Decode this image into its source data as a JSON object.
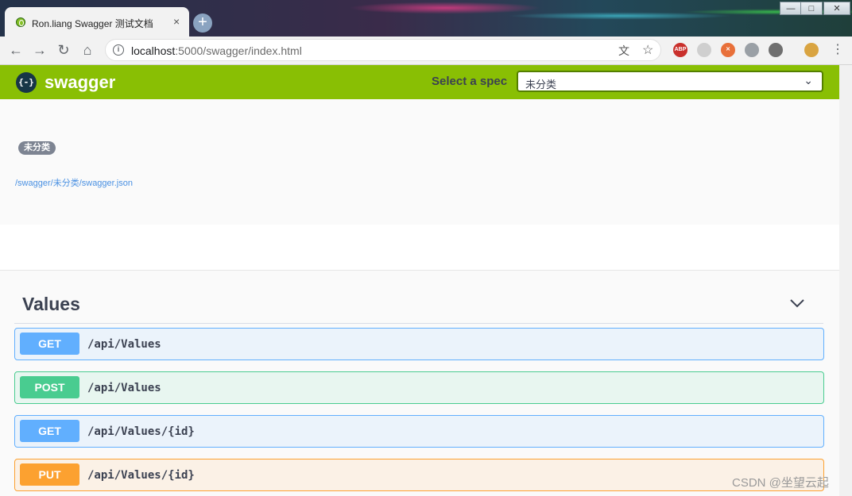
{
  "browser": {
    "tab_title": "Ron.liang Swagger 测试文档",
    "tab_close": "×",
    "new_tab": "+",
    "window_controls": {
      "minimize": "—",
      "maximize": "□",
      "close": "✕"
    },
    "url_host": "localhost",
    "url_path": ":5000/swagger/index.html",
    "extensions": [
      {
        "name": "adblock-icon",
        "label": "ABP",
        "color": "#c9302c"
      },
      {
        "name": "sync-icon",
        "label": "",
        "color": "#cfcfcf"
      },
      {
        "name": "close-circle-icon",
        "label": "✕",
        "color": "#e8703a"
      },
      {
        "name": "vue-icon",
        "label": "",
        "color": "#9aa0a6"
      },
      {
        "name": "dev-icon",
        "label": "",
        "color": "#6f6f6f"
      },
      {
        "name": "avatar-icon",
        "label": "",
        "color": "#d9a441"
      }
    ]
  },
  "swagger": {
    "logo_text": "{-}",
    "brand": "swagger",
    "select_label": "Select a spec",
    "selected_spec": "未分类",
    "chevron": "⌄",
    "colors": {
      "topbar": "#89bf04",
      "get": "#61affe",
      "post": "#49cc90",
      "put": "#fca130"
    }
  },
  "info": {
    "badge": "未分类",
    "spec_url": "/swagger/未分类/swagger.json"
  },
  "tag": {
    "title": "Values"
  },
  "operations": [
    {
      "method": "GET",
      "path": "/api/Values"
    },
    {
      "method": "POST",
      "path": "/api/Values"
    },
    {
      "method": "GET",
      "path": "/api/Values/{id}"
    },
    {
      "method": "PUT",
      "path": "/api/Values/{id}"
    }
  ],
  "watermark": "CSDN @坐望云起"
}
